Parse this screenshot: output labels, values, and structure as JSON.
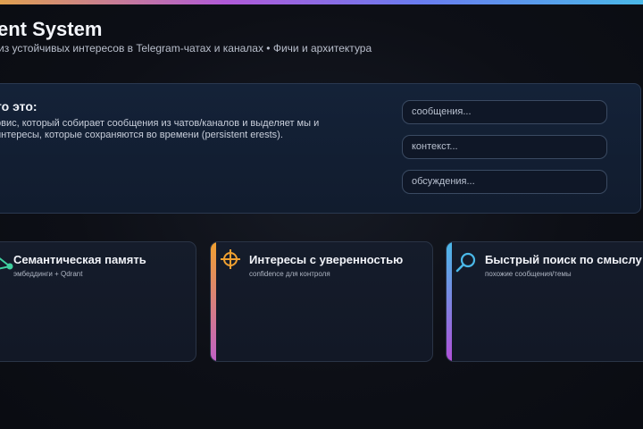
{
  "header": {
    "title": "ent System",
    "subtitle": "из устойчивых интересов в Telegram-чатах и каналах • Фичи и архитектура"
  },
  "hero": {
    "heading": "то это:",
    "description": "рвис, который собирает сообщения из чатов/каналов и выделяет мы и интересы, которые сохраняются во времени (persistent erests).",
    "inputs": [
      {
        "placeholder": "сообщения..."
      },
      {
        "placeholder": "контекст..."
      },
      {
        "placeholder": "обсуждения..."
      }
    ]
  },
  "cards": [
    {
      "title": "Семантическая память",
      "subtitle": "эмбеддинги + Qdrant",
      "icon": "graph-nodes-icon",
      "accent": [
        "#3fd0a0",
        "#2aa080"
      ]
    },
    {
      "title": "Интересы с уверенностью",
      "subtitle": "confidence для контроля",
      "icon": "crosshair-target-icon",
      "accent": [
        "#f0a030",
        "#b050d8"
      ]
    },
    {
      "title": "Быстрый поиск по смыслу",
      "subtitle": "похожие сообщения/темы",
      "icon": "magnifier-icon",
      "accent": [
        "#4ab8e8",
        "#b050d8"
      ]
    }
  ],
  "colors": {
    "background": "#0d0f16",
    "hero_bg": "#132036",
    "card_bg": "#141a28",
    "text_primary": "#f1f3f8",
    "text_secondary": "#b9bfcc"
  }
}
